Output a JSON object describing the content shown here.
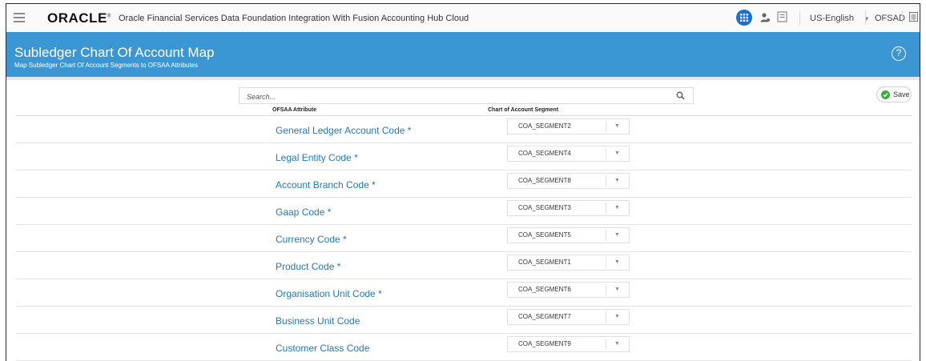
{
  "header": {
    "logo": "ORACLE",
    "logo_mark": "®",
    "app_title": "Oracle Financial Services Data Foundation Integration With Fusion Accounting Hub Cloud",
    "language": "US-English",
    "user": "OFSAD",
    "icons": [
      "menu-icon",
      "apps-grid-icon",
      "user-icon",
      "document-icon",
      "window-icon"
    ]
  },
  "page": {
    "title": "Subledger Chart Of Account Map",
    "subtitle": "Map Subledger Chart Of Account Segments to OFSAA Attributes",
    "help_label": "?"
  },
  "toolbar": {
    "search_placeholder": "Search...",
    "save_label": "Save"
  },
  "table": {
    "columns": [
      "OFSAA Attribute",
      "Chart of Account Segment"
    ],
    "rows": [
      {
        "attribute": "General Ledger Account Code *",
        "segment": "COA_SEGMENT2"
      },
      {
        "attribute": "Legal Entity Code *",
        "segment": "COA_SEGMENT4"
      },
      {
        "attribute": "Account Branch Code *",
        "segment": "COA_SEGMENT8"
      },
      {
        "attribute": "Gaap Code *",
        "segment": "COA_SEGMENT3"
      },
      {
        "attribute": "Currency Code *",
        "segment": "COA_SEGMENT5"
      },
      {
        "attribute": "Product Code *",
        "segment": "COA_SEGMENT1"
      },
      {
        "attribute": "Organisation Unit Code *",
        "segment": "COA_SEGMENT6"
      },
      {
        "attribute": "Business Unit Code",
        "segment": "COA_SEGMENT7"
      },
      {
        "attribute": "Customer Class Code",
        "segment": "COA_SEGMENT9"
      }
    ]
  },
  "colors": {
    "band": "#3b97d3",
    "link": "#2178bd",
    "apps_button": "#1a6fd1",
    "save_check": "#3cad3c"
  }
}
